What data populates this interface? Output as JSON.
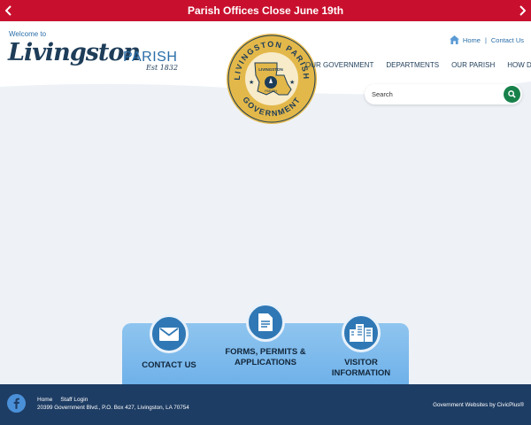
{
  "alert": {
    "message": "Parish Offices Close June 19th"
  },
  "branding": {
    "welcome": "Welcome to",
    "name_script": "Livingston",
    "name_suffix": "PARISH",
    "est": "Est 1832",
    "seal_top": "LIVINGSTON PARISH",
    "seal_bottom": "GOVERNMENT",
    "seal_center": "LIVINGSTON",
    "seal_center_sub": "PARISH"
  },
  "utility": {
    "home": "Home",
    "separator": "|",
    "contact": "Contact Us"
  },
  "nav": {
    "items": [
      "OUR GOVERNMENT",
      "DEPARTMENTS",
      "OUR PARISH",
      "HOW DO I"
    ]
  },
  "search": {
    "placeholder": "Search"
  },
  "quick_links": [
    {
      "label": "CONTACT US",
      "icon": "envelope-icon"
    },
    {
      "label_line1": "FORMS, PERMITS &",
      "label_line2": "APPLICATIONS",
      "icon": "document-icon"
    },
    {
      "label_line1": "VISITOR",
      "label_line2": "INFORMATION",
      "icon": "buildings-icon"
    }
  ],
  "footer": {
    "links": [
      "Home",
      "Staff Login"
    ],
    "address": "20399 Government Blvd., P.O. Box 427, Livingston, LA 70754",
    "credit": "Government Websites by CivicPlus®"
  },
  "colors": {
    "alert": "#c8102e",
    "navy": "#1e3d64",
    "accent_blue": "#2a6ea8",
    "search_button": "#17814a",
    "seal_gold": "#e3b84a"
  }
}
